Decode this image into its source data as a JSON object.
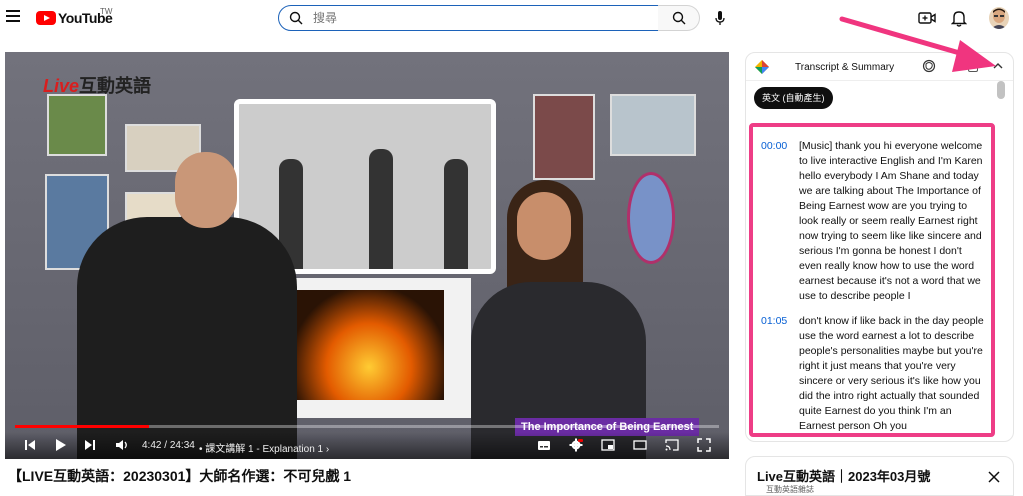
{
  "header": {
    "logo_text": "YouTube",
    "logo_country": "TW",
    "search_placeholder": "搜尋",
    "search_value": "",
    "icons": [
      "menu-icon",
      "search-icon",
      "mic-icon",
      "create-icon",
      "bell-icon"
    ]
  },
  "player": {
    "channel_logo": {
      "live": "Live",
      "name": "互動英語"
    },
    "lower_third": "The Importance of Being Earnest",
    "time_current": "4:42",
    "time_total": "24:34",
    "time_separator": " / ",
    "chapter": "課文講解 1 - Explanation 1",
    "progress": 0.19,
    "colors": {
      "progress": "#ff0000",
      "lower_third": "#6a2ca3"
    }
  },
  "video": {
    "title": "【LIVE互動英語：20230301】大師名作選：不可兒戲 1"
  },
  "transcript_panel": {
    "title": "Transcript & Summary",
    "language_chip": "英文 (自動產生)",
    "highlight_color": "#ee3d86",
    "segments": [
      {
        "time": "00:00",
        "text": "[Music] thank you hi everyone welcome to live interactive English and I'm Karen hello everybody I Am Shane and today we are talking about The Importance of Being Earnest wow are you trying to look really or seem really Earnest right now trying to seem like like sincere and serious I'm gonna be honest I don't even really know how to use the word earnest because it's not a word that we use to describe people I"
      },
      {
        "time": "01:05",
        "text": "don't know if like back in the day people use the word earnest a lot to describe people's personalities maybe but you're right it just means that you're very sincere or very serious it's like how you did the intro right actually that sounded quite Earnest do you think I'm an Earnest person Oh you"
      }
    ]
  },
  "side_card": {
    "title": "Live互動英語｜2023年03月號",
    "subtitle": "互動英語雜誌"
  },
  "annotation": {
    "arrow_color": "#f0357f"
  }
}
